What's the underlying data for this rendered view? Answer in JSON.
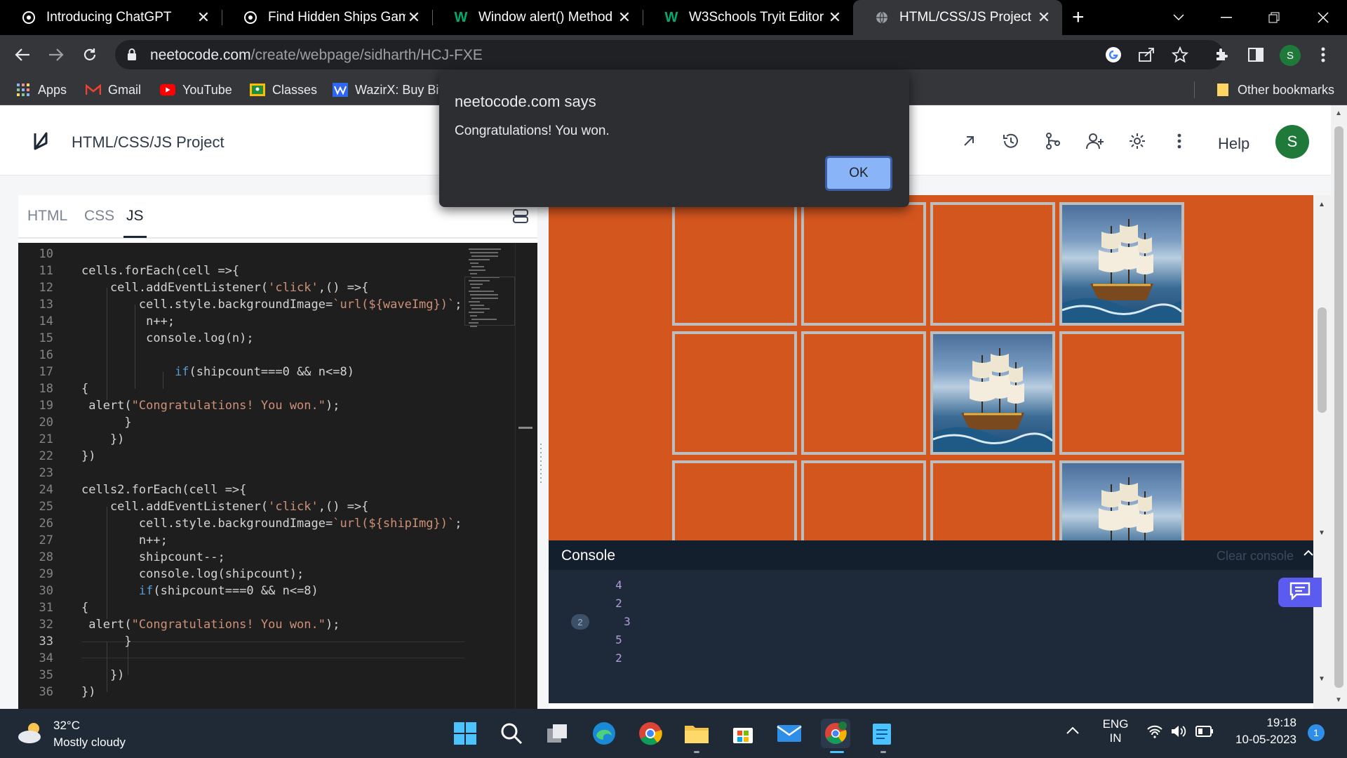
{
  "browser": {
    "tabs": [
      {
        "title": "Introducing ChatGPT",
        "icon": "chatgpt-icon"
      },
      {
        "title": "Find Hidden Ships Game",
        "icon": "chatgpt-icon"
      },
      {
        "title": "Window alert() Method",
        "icon": "w3schools-icon"
      },
      {
        "title": "W3Schools Tryit Editor",
        "icon": "w3schools-icon"
      },
      {
        "title": "HTML/CSS/JS Project",
        "icon": "globe-icon",
        "active": true
      }
    ],
    "new_tab_label": "+",
    "url_host": "neetocode.com",
    "url_path": "/create/webpage/sidharth/HCJ-FXE",
    "profile_initial": "S",
    "bookmarks": [
      {
        "label": "Apps",
        "icon": "apps-grid-icon"
      },
      {
        "label": "Gmail",
        "icon": "gmail-icon"
      },
      {
        "label": "YouTube",
        "icon": "youtube-icon"
      },
      {
        "label": "Classes",
        "icon": "classroom-icon"
      },
      {
        "label": "WazirX: Buy Bit",
        "icon": "wazirx-icon"
      }
    ],
    "other_bookmarks": "Other bookmarks"
  },
  "app": {
    "project_title": "HTML/CSS/JS Project",
    "help_label": "Help",
    "avatar_initial": "S"
  },
  "editor": {
    "tabs": [
      "HTML",
      "CSS",
      "JS"
    ],
    "active_tab": "JS",
    "lines": [
      {
        "n": "10",
        "text": ""
      },
      {
        "n": "11",
        "text": "cells.forEach(cell =>{"
      },
      {
        "n": "12",
        "text": "    cell.addEventListener('click',() =>{"
      },
      {
        "n": "13",
        "text": "        cell.style.backgroundImage=`url(${waveImg})`;"
      },
      {
        "n": "14",
        "text": "         n++;"
      },
      {
        "n": "15",
        "text": "         console.log(n);"
      },
      {
        "n": "16",
        "text": ""
      },
      {
        "n": "17",
        "text": "             if(shipcount===0 && n<=8)"
      },
      {
        "n": "18",
        "text": "{"
      },
      {
        "n": "19",
        "text": " alert(\"Congratulations! You won.\");"
      },
      {
        "n": "20",
        "text": "      }"
      },
      {
        "n": "21",
        "text": "    })"
      },
      {
        "n": "22",
        "text": "})"
      },
      {
        "n": "23",
        "text": ""
      },
      {
        "n": "24",
        "text": "cells2.forEach(cell =>{"
      },
      {
        "n": "25",
        "text": "    cell.addEventListener('click',() =>{"
      },
      {
        "n": "26",
        "text": "        cell.style.backgroundImage=`url(${shipImg})`;"
      },
      {
        "n": "27",
        "text": "        n++;"
      },
      {
        "n": "28",
        "text": "        shipcount--;"
      },
      {
        "n": "29",
        "text": "        console.log(shipcount);"
      },
      {
        "n": "30",
        "text": "        if(shipcount===0 && n<=8)"
      },
      {
        "n": "31",
        "text": "{"
      },
      {
        "n": "32",
        "text": " alert(\"Congratulations! You won.\");"
      },
      {
        "n": "33",
        "text": "      }"
      },
      {
        "n": "34",
        "text": ""
      },
      {
        "n": "35",
        "text": "    })"
      },
      {
        "n": "36",
        "text": "})"
      }
    ],
    "current_line": "33"
  },
  "preview": {
    "background_color": "#d4561f",
    "grid": [
      [
        "empty",
        "empty",
        "empty",
        "ship"
      ],
      [
        "empty",
        "empty",
        "ship",
        "empty"
      ],
      [
        "empty",
        "empty",
        "empty",
        "ship"
      ]
    ]
  },
  "console": {
    "title": "Console",
    "clear_label": "Clear console",
    "entries": [
      {
        "value": "4",
        "count": ""
      },
      {
        "value": "2",
        "count": ""
      },
      {
        "value": "3",
        "count": "2"
      },
      {
        "value": "5",
        "count": ""
      },
      {
        "value": "2",
        "count": ""
      }
    ]
  },
  "dialog": {
    "title": "neetocode.com says",
    "message": "Congratulations! You won.",
    "ok_label": "OK"
  },
  "taskbar": {
    "temperature": "32°C",
    "weather": "Mostly cloudy",
    "language": "ENG",
    "region": "IN",
    "time": "19:18",
    "date": "10-05-2023",
    "notifications": "1"
  }
}
